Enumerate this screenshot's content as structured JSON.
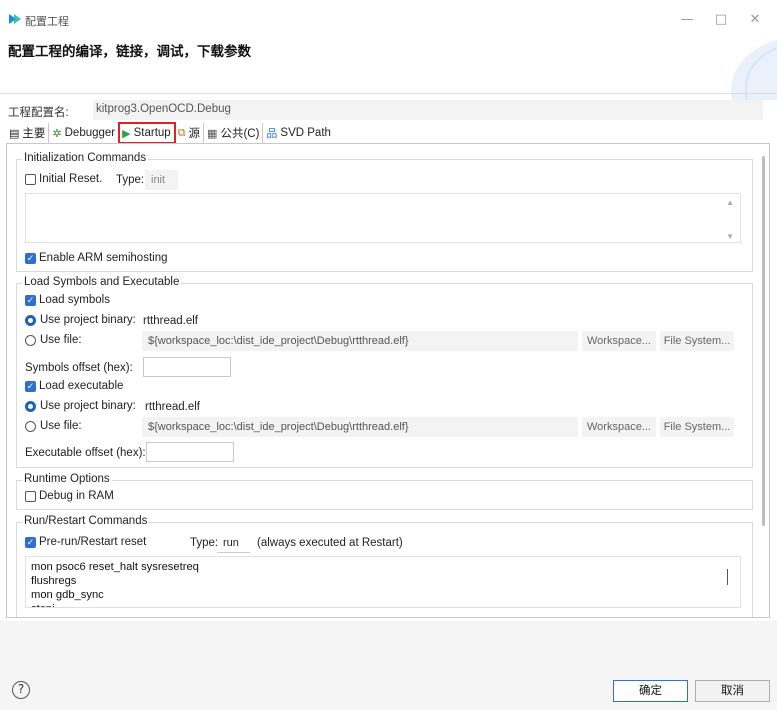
{
  "window": {
    "title": "配置工程",
    "minimize_glyph": "—",
    "maximize_glyph": "□",
    "close_glyph": "✕"
  },
  "heading": "配置工程的编译，链接，调试，下载参数",
  "config_name": {
    "label": "工程配置名:",
    "value": "kitprog3.OpenOCD.Debug"
  },
  "tabs": [
    {
      "label": "主要",
      "icon": "main-tab-icon",
      "glyph": "▤"
    },
    {
      "label": "Debugger",
      "icon": "debugger-tab-icon",
      "glyph": "✲"
    },
    {
      "label": "Startup",
      "icon": "play-icon",
      "glyph": "▶",
      "active": true
    },
    {
      "label": "源",
      "icon": "source-tab-icon",
      "glyph": "⧉"
    },
    {
      "label": "公共(C)",
      "icon": "common-tab-icon",
      "glyph": "▦"
    },
    {
      "label": "SVD Path",
      "icon": "svd-tab-icon",
      "glyph": "品"
    }
  ],
  "init_commands": {
    "title": "Initialization Commands",
    "initial_reset_label": "Initial Reset.",
    "type_label": "Type:",
    "type_value": "init",
    "enable_semihosting_label": "Enable ARM semihosting",
    "initial_reset_checked": false,
    "semihosting_checked": true
  },
  "load_symbols": {
    "title": "Load Symbols and Executable",
    "load_symbols_label": "Load symbols",
    "use_project_binary_label": "Use project binary:",
    "symbols_binary": "rtthread.elf",
    "use_file_label": "Use file:",
    "symbols_file_path": "${workspace_loc:\\dist_ide_project\\Debug\\rtthread.elf}",
    "workspace_btn": "Workspace...",
    "filesystem_btn": "File System...",
    "symbols_offset_label": "Symbols offset (hex):",
    "load_executable_label": "Load executable",
    "exec_binary": "rtthread.elf",
    "exec_file_path": "${workspace_loc:\\dist_ide_project\\Debug\\rtthread.elf}",
    "exec_offset_label": "Executable offset (hex):"
  },
  "runtime": {
    "title": "Runtime Options",
    "debug_in_ram_label": "Debug in RAM"
  },
  "run_restart": {
    "title": "Run/Restart Commands",
    "prerun_label": "Pre-run/Restart reset",
    "type_label": "Type:",
    "type_value": "run",
    "note": "(always executed at Restart)",
    "commands": [
      "mon psoc6 reset_halt sysresetreq",
      "flushregs",
      "mon gdb_sync",
      "stepi"
    ]
  },
  "footer": {
    "help_glyph": "?",
    "ok_label": "确定",
    "cancel_label": "取消"
  },
  "colors": {
    "accent": "#2f6fd0",
    "highlight": "#e0202a",
    "startup_icon": "#2aa34a"
  }
}
